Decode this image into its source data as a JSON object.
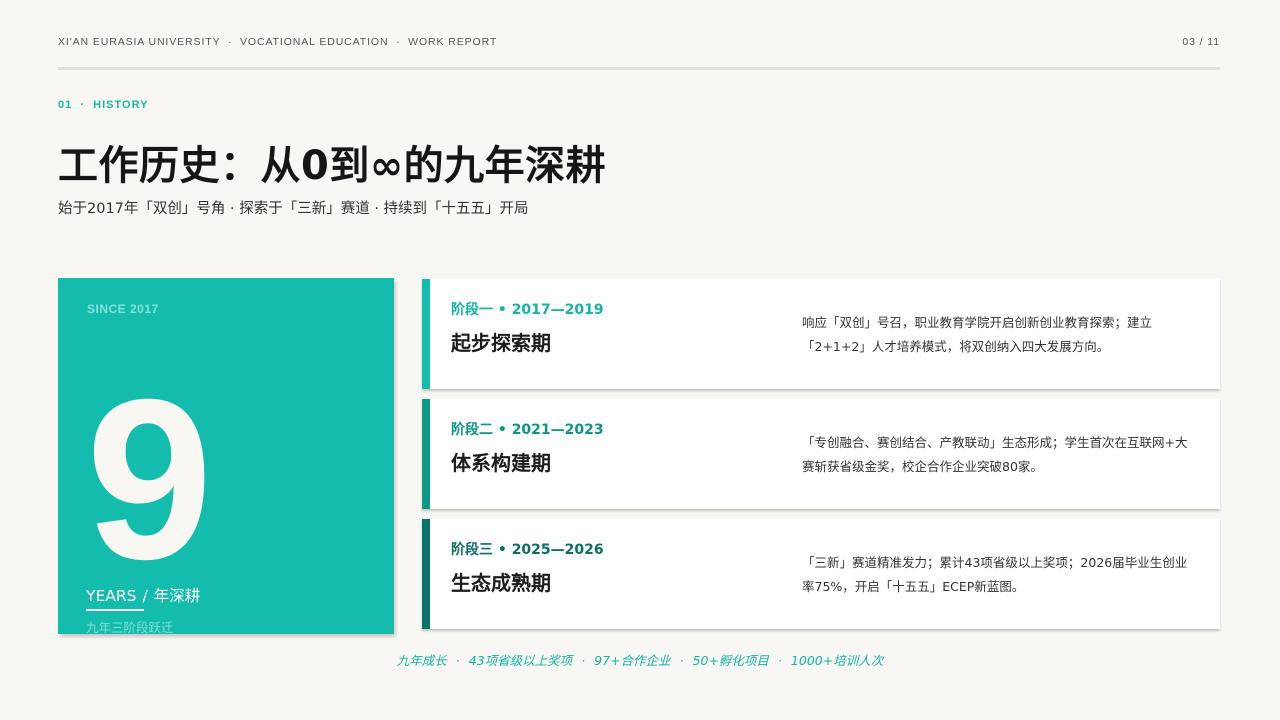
{
  "header": {
    "org": "XI'AN EURASIA UNIVERSITY",
    "dept": "VOCATIONAL EDUCATION",
    "doc": "WORK REPORT",
    "separator": "·",
    "page": "03 / 11"
  },
  "section": {
    "number": "01",
    "separator": "·",
    "name": "HISTORY"
  },
  "title": "工作历史：从0到∞的九年深耕",
  "subtitle": "始于2017年「双创」号角 · 探索于「三新」赛道 · 持续到「十五五」开局",
  "highlight": {
    "since": "SINCE 2017",
    "number": "9",
    "unit_en": "YEARS",
    "slash": "/",
    "unit_cn": "年深耕",
    "caption": "九年三阶段跃迁"
  },
  "stages": [
    {
      "label": "阶段一 • 2017—2019",
      "name": "起步探索期",
      "desc": "响应「双创」号召，职业教育学院开启创新创业教育探索；建立「2+1+2」人才培养模式，将双创纳入四大发展方向。"
    },
    {
      "label": "阶段二 • 2021—2023",
      "name": "体系构建期",
      "desc": "「专创融合、赛创结合、产教联动」生态形成；学生首次在互联网+大赛斩获省级金奖，校企合作企业突破80家。"
    },
    {
      "label": "阶段三 • 2025—2026",
      "name": "生态成熟期",
      "desc": "「三新」赛道精准发力；累计43项省级以上奖项；2026届毕业生创业率75%，开启「十五五」ECEP新蓝图。"
    }
  ],
  "footer": {
    "separator": "·",
    "items": [
      "九年成长",
      "43项省级以上奖项",
      "97+合作企业",
      "50+孵化项目",
      "1000+培训人次"
    ]
  },
  "colors": {
    "accent": "#13bcad",
    "stage1": "#13bcad",
    "stage2": "#0e9a8a",
    "stage3": "#0a7367",
    "background": "#f8f7f3"
  }
}
